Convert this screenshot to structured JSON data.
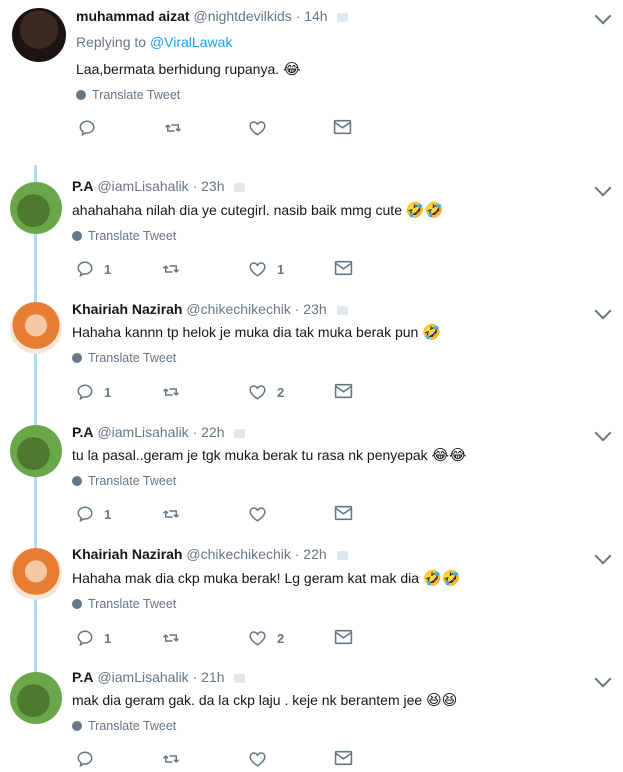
{
  "translate_label": "Translate Tweet",
  "tweets": [
    {
      "name": "muhammad aizat",
      "handle": "@nightdevilkids",
      "time": "· 14h",
      "replying_prefix": "Replying to",
      "replying_to": "@ViralLawak",
      "text": "Laa,bermata berhidung rupanya.",
      "emoji": "😂",
      "reply_count": "",
      "like_count": "",
      "avatar": "dark-portrait"
    },
    {
      "name": "P.A",
      "handle": "@iamLisahalik",
      "time": "· 23h",
      "text": "ahahahaha nilah dia ye cutegirl. nasib baik mmg cute",
      "emoji": "🤣🤣",
      "reply_count": "1",
      "like_count": "1",
      "avatar": "green-landscape"
    },
    {
      "name": "Khairiah Nazirah",
      "handle": "@chikechikechik",
      "time": "· 23h",
      "text": "Hahaha kannn tp helok je muka dia tak muka berak pun",
      "emoji": "🤣",
      "reply_count": "1",
      "like_count": "2",
      "avatar": "orange-hijab"
    },
    {
      "name": "P.A",
      "handle": "@iamLisahalik",
      "time": "· 22h",
      "text": "tu la pasal..geram je tgk muka berak tu rasa nk penyepak",
      "emoji": "😂😂",
      "reply_count": "1",
      "like_count": "",
      "avatar": "green-landscape"
    },
    {
      "name": "Khairiah Nazirah",
      "handle": "@chikechikechik",
      "time": "· 22h",
      "text": "Hahaha mak dia ckp muka berak! Lg geram kat mak dia",
      "emoji": "🤣🤣",
      "reply_count": "1",
      "like_count": "2",
      "avatar": "orange-hijab"
    },
    {
      "name": "P.A",
      "handle": "@iamLisahalik",
      "time": "· 21h",
      "text": "mak dia geram gak. da la ckp laju . keje nk berantem jee",
      "emoji": "😆😆",
      "reply_count": "",
      "like_count": "",
      "avatar": "green-landscape"
    }
  ],
  "colors": {
    "link": "#1da1f2",
    "muted": "#657786",
    "thread_line": "#b1dcf9"
  },
  "icons": [
    "reply-icon",
    "retweet-icon",
    "like-icon",
    "dm-icon",
    "chevron-down-icon",
    "globe-icon"
  ]
}
